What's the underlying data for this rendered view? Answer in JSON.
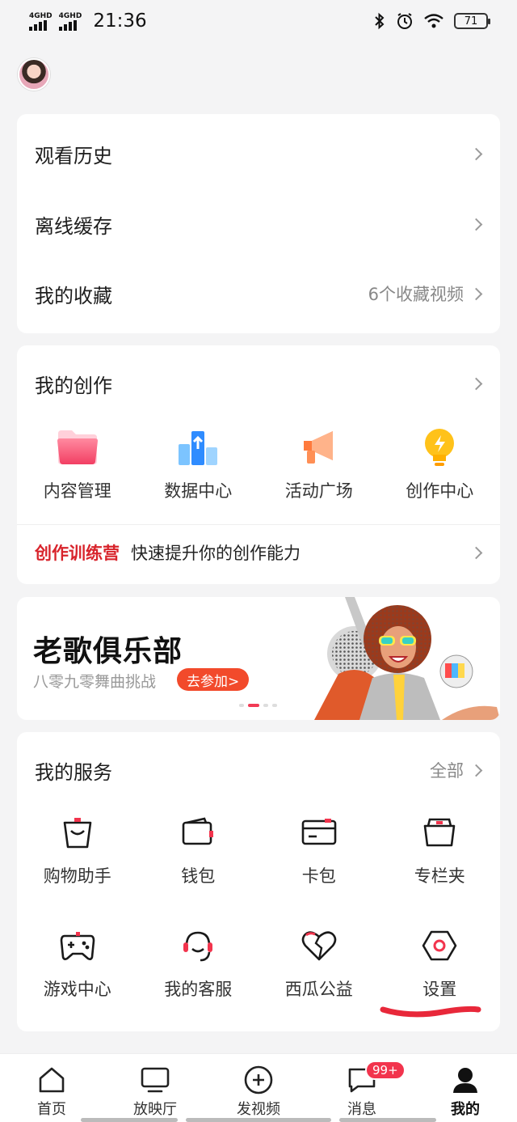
{
  "status": {
    "sim1": "4GHD",
    "sim2": "4GHD",
    "time": "21:36",
    "battery": "71"
  },
  "menu": {
    "history": "观看历史",
    "offline": "离线缓存",
    "favorites": "我的收藏",
    "favorites_count": "6个收藏视频"
  },
  "creation": {
    "title": "我的创作",
    "items": [
      {
        "label": "内容管理",
        "icon": "folder-icon"
      },
      {
        "label": "数据中心",
        "icon": "data-chart-icon"
      },
      {
        "label": "活动广场",
        "icon": "megaphone-icon"
      },
      {
        "label": "创作中心",
        "icon": "lightbulb-icon"
      }
    ],
    "camp_label": "创作训练营",
    "camp_desc": "快速提升你的创作能力"
  },
  "banner": {
    "title": "老歌俱乐部",
    "subtitle": "八零九零舞曲挑战",
    "join": "去参加>"
  },
  "services": {
    "title": "我的服务",
    "all": "全部",
    "items": [
      {
        "label": "购物助手",
        "icon": "shopping-bag-icon"
      },
      {
        "label": "钱包",
        "icon": "wallet-icon"
      },
      {
        "label": "卡包",
        "icon": "card-icon"
      },
      {
        "label": "专栏夹",
        "icon": "folder-column-icon"
      },
      {
        "label": "游戏中心",
        "icon": "gamepad-icon"
      },
      {
        "label": "我的客服",
        "icon": "headset-icon"
      },
      {
        "label": "西瓜公益",
        "icon": "heart-icon"
      },
      {
        "label": "设置",
        "icon": "settings-hex-icon"
      }
    ]
  },
  "tabs": [
    {
      "label": "首页",
      "icon": "home-icon"
    },
    {
      "label": "放映厅",
      "icon": "tv-icon"
    },
    {
      "label": "发视频",
      "icon": "plus-circle-icon"
    },
    {
      "label": "消息",
      "icon": "message-icon",
      "badge": "99+"
    },
    {
      "label": "我的",
      "icon": "profile-icon"
    }
  ],
  "colors": {
    "accent": "#f2344d",
    "camp_red": "#d8242c",
    "annotation_red": "#e8283a"
  }
}
